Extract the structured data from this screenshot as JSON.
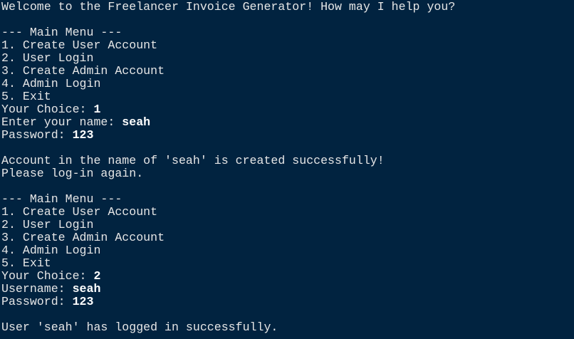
{
  "colors": {
    "background": "#012340",
    "text": "#e6e6e6"
  },
  "lines": [
    {
      "text": "Welcome to the Freelancer Invoice Generator! How may I help you?"
    },
    {
      "text": ""
    },
    {
      "text": "--- Main Menu ---"
    },
    {
      "text": "1. Create User Account"
    },
    {
      "text": "2. User Login"
    },
    {
      "text": "3. Create Admin Account"
    },
    {
      "text": "4. Admin Login"
    },
    {
      "text": "5. Exit"
    },
    {
      "text": "Your Choice: ",
      "input": "1"
    },
    {
      "text": "Enter your name: ",
      "input": "seah"
    },
    {
      "text": "Password: ",
      "input": "123"
    },
    {
      "text": ""
    },
    {
      "text": "Account in the name of 'seah' is created successfully!"
    },
    {
      "text": "Please log-in again."
    },
    {
      "text": ""
    },
    {
      "text": "--- Main Menu ---"
    },
    {
      "text": "1. Create User Account"
    },
    {
      "text": "2. User Login"
    },
    {
      "text": "3. Create Admin Account"
    },
    {
      "text": "4. Admin Login"
    },
    {
      "text": "5. Exit"
    },
    {
      "text": "Your Choice: ",
      "input": "2"
    },
    {
      "text": "Username: ",
      "input": "seah"
    },
    {
      "text": "Password: ",
      "input": "123"
    },
    {
      "text": ""
    },
    {
      "text": "User 'seah' has logged in successfully."
    }
  ]
}
